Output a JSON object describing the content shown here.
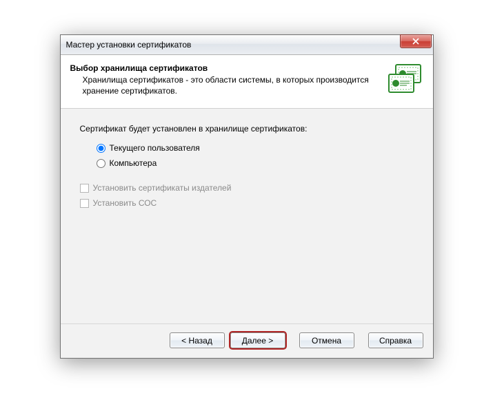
{
  "titlebar": {
    "title": "Мастер установки сертификатов"
  },
  "header": {
    "title": "Выбор хранилища сертификатов",
    "desc": "Хранилища сертификатов - это области системы, в которых производится хранение сертификатов."
  },
  "content": {
    "instruction": "Сертификат будет установлен в хранилище сертификатов:",
    "radios": [
      {
        "label": "Текущего пользователя",
        "checked": true
      },
      {
        "label": "Компьютера",
        "checked": false
      }
    ],
    "checks": [
      {
        "label": "Установить сертификаты издателей",
        "disabled": true
      },
      {
        "label": "Установить СОС",
        "disabled": true
      }
    ]
  },
  "buttons": {
    "back": "< Назад",
    "next": "Далее >",
    "cancel": "Отмена",
    "help": "Справка"
  }
}
